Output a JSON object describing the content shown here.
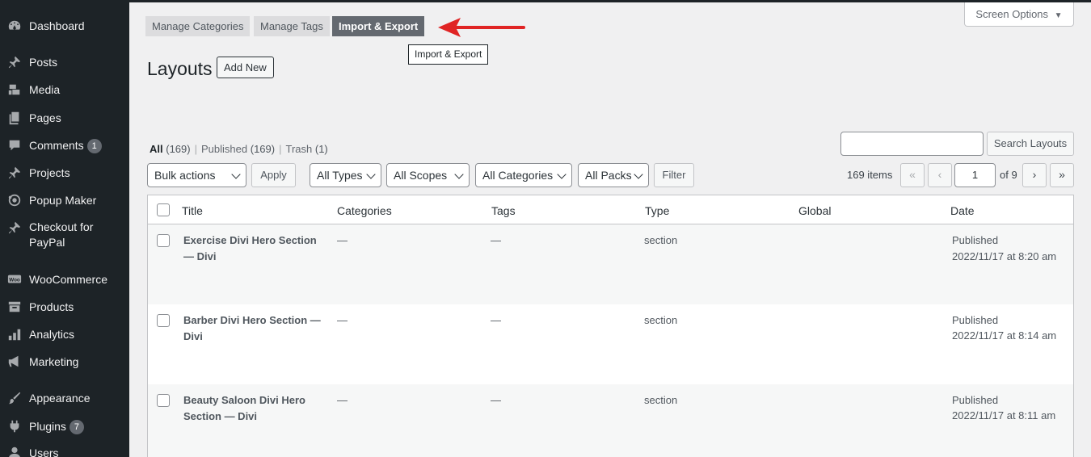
{
  "sidebar": {
    "items": [
      {
        "label": "Dashboard",
        "icon": "dashboard-icon"
      },
      {
        "label": "Posts",
        "icon": "pushpin-icon"
      },
      {
        "label": "Media",
        "icon": "media-icon"
      },
      {
        "label": "Pages",
        "icon": "pages-icon"
      },
      {
        "label": "Comments",
        "icon": "comment-icon",
        "badge": "1"
      },
      {
        "label": "Projects",
        "icon": "pushpin-icon"
      },
      {
        "label": "Popup Maker",
        "icon": "popup-maker-icon"
      },
      {
        "label": "Checkout for PayPal",
        "icon": "pushpin-icon"
      },
      {
        "label": "WooCommerce",
        "icon": "woocommerce-icon"
      },
      {
        "label": "Products",
        "icon": "archive-icon"
      },
      {
        "label": "Analytics",
        "icon": "bar-chart-icon"
      },
      {
        "label": "Marketing",
        "icon": "megaphone-icon"
      },
      {
        "label": "Appearance",
        "icon": "paintbrush-icon"
      },
      {
        "label": "Plugins",
        "icon": "plug-icon",
        "badge": "7"
      },
      {
        "label": "Users",
        "icon": "users-icon"
      }
    ]
  },
  "tabs": {
    "manage_categories": "Manage Categories",
    "manage_tags": "Manage Tags",
    "import_export": "Import & Export",
    "tooltip": "Import & Export"
  },
  "screen_options": "Screen Options",
  "page_title": "Layouts",
  "add_new": "Add New",
  "views": {
    "all": "All",
    "all_count": "(169)",
    "published": "Published",
    "published_count": "(169)",
    "trash": "Trash",
    "trash_count": "(1)"
  },
  "search": {
    "value": "",
    "button": "Search Layouts"
  },
  "filters": {
    "bulk_actions": "Bulk actions",
    "apply": "Apply",
    "types": "All Types",
    "scopes": "All Scopes",
    "categories": "All Categories",
    "packs": "All Packs",
    "filter": "Filter"
  },
  "pagination": {
    "items": "169 items",
    "first": "«",
    "prev": "‹",
    "current": "1",
    "of": "of 9",
    "next": "›",
    "last": "»"
  },
  "table": {
    "columns": [
      "Title",
      "Categories",
      "Tags",
      "Type",
      "Global",
      "Date"
    ],
    "rows": [
      {
        "title": "Exercise Divi Hero Section — Divi",
        "categories": "—",
        "tags": "—",
        "type": "section",
        "global": "",
        "status": "Published",
        "date": "2022/11/17 at 8:20 am"
      },
      {
        "title": "Barber Divi Hero Section — Divi",
        "categories": "—",
        "tags": "—",
        "type": "section",
        "global": "",
        "status": "Published",
        "date": "2022/11/17 at 8:14 am"
      },
      {
        "title": "Beauty Saloon Divi Hero Section — Divi",
        "categories": "—",
        "tags": "—",
        "type": "section",
        "global": "",
        "status": "Published",
        "date": "2022/11/17 at 8:11 am"
      }
    ]
  },
  "colors": {
    "sidebar_bg": "#1d2327",
    "active_tab": "#646970",
    "arrow": "#e02424"
  }
}
